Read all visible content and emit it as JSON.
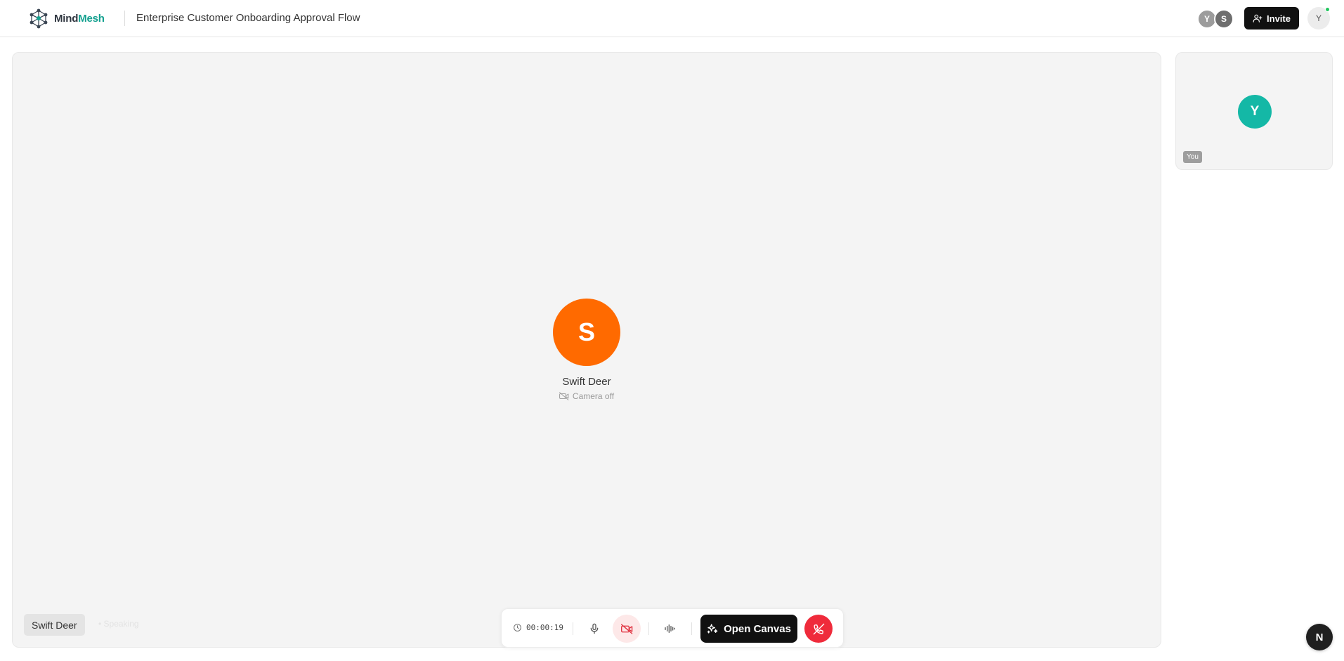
{
  "header": {
    "brand": {
      "part1": "Mind",
      "part2": "Mesh"
    },
    "meeting_title": "Enterprise Customer Onboarding Approval Flow",
    "participants": [
      {
        "initial": "Y",
        "color": "#9c9c9c"
      },
      {
        "initial": "S",
        "color": "#6e6e6e"
      }
    ],
    "invite_label": "Invite",
    "user_initial": "Y",
    "online_color": "#22c55e"
  },
  "stage": {
    "speaker": {
      "initial": "S",
      "name": "Swift Deer",
      "camera_status": "Camera off",
      "color": "#ff6a00"
    },
    "name_tag": "Swift Deer",
    "speaking_label": "• Speaking"
  },
  "controls": {
    "timer": "00:00:19",
    "open_canvas_label": "Open Canvas",
    "icons": [
      "clock-icon",
      "microphone-icon",
      "camera-off-icon",
      "audio-waveform-icon",
      "sparkles-icon",
      "phone-off-icon"
    ]
  },
  "self_tile": {
    "initial": "Y",
    "label": "You",
    "color": "#14b8a6"
  },
  "floating_badge": {
    "label": "N"
  }
}
